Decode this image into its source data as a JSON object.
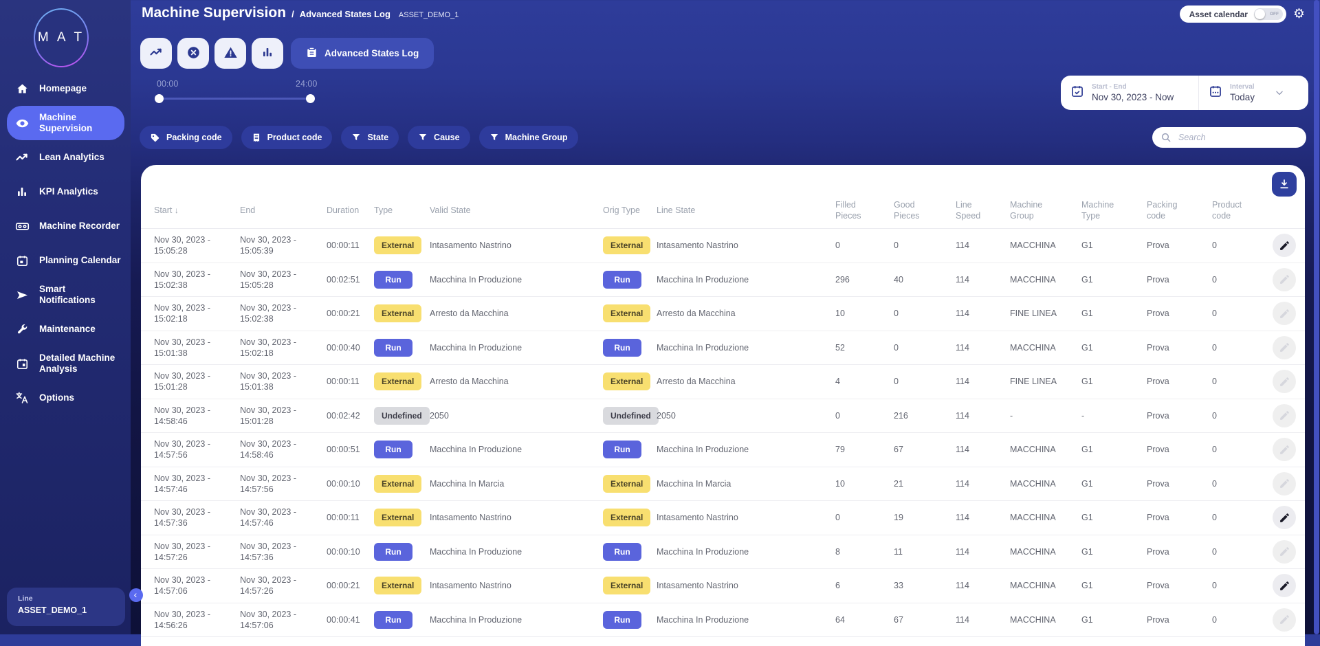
{
  "header": {
    "title": "Machine Supervision",
    "breadcrumb_separator": "/",
    "breadcrumb": "Advanced States Log",
    "asset_id": "ASSET_DEMO_1",
    "asset_calendar_label": "Asset calendar",
    "asset_calendar_toggle": "OFF"
  },
  "sidebar": {
    "logo_text": "M A T",
    "items": [
      {
        "label": "Homepage",
        "icon": "home-icon",
        "active": false
      },
      {
        "label": "Machine Supervision",
        "icon": "eye-icon",
        "active": true
      },
      {
        "label": "Lean Analytics",
        "icon": "trend-icon",
        "active": false
      },
      {
        "label": "KPI Analytics",
        "icon": "bar-chart-icon",
        "active": false
      },
      {
        "label": "Machine Recorder",
        "icon": "recorder-icon",
        "active": false
      },
      {
        "label": "Planning Calendar",
        "icon": "calendar-icon",
        "active": false
      },
      {
        "label": "Smart Notifications",
        "icon": "send-icon",
        "active": false
      },
      {
        "label": "Maintenance",
        "icon": "wrench-icon",
        "active": false
      },
      {
        "label": "Detailed Machine Analysis",
        "icon": "calendar-analysis-icon",
        "active": false
      },
      {
        "label": "Options",
        "icon": "translate-icon",
        "active": false
      }
    ],
    "line_label": "Line",
    "line_value": "ASSET_DEMO_1",
    "collapse_glyph": "‹"
  },
  "toolbar": {
    "icon_buttons": [
      {
        "icon": "trend-icon"
      },
      {
        "icon": "circle-x-icon"
      },
      {
        "icon": "warning-icon"
      },
      {
        "icon": "bar-chart-icon"
      }
    ],
    "active_view_label": "Advanced States Log",
    "active_view_icon": "clipboard-icon"
  },
  "time_slider": {
    "start_label": "00:00",
    "end_label": "24:00"
  },
  "date_picker": {
    "start_end_label": "Start - End",
    "start_end_value": "Nov 30, 2023 - Now",
    "interval_label": "Interval",
    "interval_value": "Today"
  },
  "filters": [
    {
      "label": "Packing code",
      "icon": "tag-icon"
    },
    {
      "label": "Product code",
      "icon": "receipt-icon"
    },
    {
      "label": "State",
      "icon": "funnel-icon"
    },
    {
      "label": "Cause",
      "icon": "funnel-icon"
    },
    {
      "label": "Machine Group",
      "icon": "funnel-icon"
    }
  ],
  "search": {
    "placeholder": "Search"
  },
  "colors": {
    "accent": "#5a6af0",
    "scrollbar": "#4350c0",
    "badge_external_bg": "#f8df70",
    "badge_external_fg": "#4a4327",
    "badge_run_bg": "#5a64dc",
    "badge_run_fg": "#ffffff",
    "badge_undefined_bg": "#d9dade",
    "badge_undefined_fg": "#3d3d49"
  },
  "table": {
    "columns": [
      {
        "id": "start",
        "lines": [
          "Start"
        ],
        "sorted": "desc"
      },
      {
        "id": "end",
        "lines": [
          "End"
        ]
      },
      {
        "id": "duration",
        "lines": [
          "Duration"
        ]
      },
      {
        "id": "type",
        "lines": [
          "Type"
        ]
      },
      {
        "id": "valid-state",
        "lines": [
          "Valid State"
        ]
      },
      {
        "id": "orig-type",
        "lines": [
          "Orig Type"
        ]
      },
      {
        "id": "line-state",
        "lines": [
          "Line State"
        ]
      },
      {
        "id": "filled-pieces",
        "lines": [
          "Filled",
          "Pieces"
        ]
      },
      {
        "id": "good-pieces",
        "lines": [
          "Good",
          "Pieces"
        ]
      },
      {
        "id": "line-speed",
        "lines": [
          "Line",
          "Speed"
        ]
      },
      {
        "id": "machine-group",
        "lines": [
          "Machine",
          "Group"
        ]
      },
      {
        "id": "machine-type",
        "lines": [
          "Machine",
          "Type"
        ]
      },
      {
        "id": "packing-code",
        "lines": [
          "Packing",
          "code"
        ]
      },
      {
        "id": "product-code",
        "lines": [
          "Product",
          "code"
        ]
      }
    ],
    "rows": [
      {
        "start": [
          "Nov 30, 2023 -",
          "15:05:28"
        ],
        "end": [
          "Nov 30, 2023 -",
          "15:05:39"
        ],
        "duration": "00:00:11",
        "type": "External",
        "valid_state": "Intasamento Nastrino",
        "orig_type": "External",
        "line_state": "Intasamento Nastrino",
        "filled_pieces": "0",
        "good_pieces": "0",
        "line_speed": "114",
        "machine_group": "MACCHINA",
        "machine_type": "G1",
        "packing_code": "Prova",
        "product_code": "0",
        "editable": true
      },
      {
        "start": [
          "Nov 30, 2023 -",
          "15:02:38"
        ],
        "end": [
          "Nov 30, 2023 -",
          "15:05:28"
        ],
        "duration": "00:02:51",
        "type": "Run",
        "valid_state": "Macchina In Produzione",
        "orig_type": "Run",
        "line_state": "Macchina In Produzione",
        "filled_pieces": "296",
        "good_pieces": "40",
        "line_speed": "114",
        "machine_group": "MACCHINA",
        "machine_type": "G1",
        "packing_code": "Prova",
        "product_code": "0",
        "editable": false
      },
      {
        "start": [
          "Nov 30, 2023 -",
          "15:02:18"
        ],
        "end": [
          "Nov 30, 2023 -",
          "15:02:38"
        ],
        "duration": "00:00:21",
        "type": "External",
        "valid_state": "Arresto da Macchina",
        "orig_type": "External",
        "line_state": "Arresto da Macchina",
        "filled_pieces": "10",
        "good_pieces": "0",
        "line_speed": "114",
        "machine_group": "FINE LINEA",
        "machine_type": "G1",
        "packing_code": "Prova",
        "product_code": "0",
        "editable": false
      },
      {
        "start": [
          "Nov 30, 2023 -",
          "15:01:38"
        ],
        "end": [
          "Nov 30, 2023 -",
          "15:02:18"
        ],
        "duration": "00:00:40",
        "type": "Run",
        "valid_state": "Macchina In Produzione",
        "orig_type": "Run",
        "line_state": "Macchina In Produzione",
        "filled_pieces": "52",
        "good_pieces": "0",
        "line_speed": "114",
        "machine_group": "MACCHINA",
        "machine_type": "G1",
        "packing_code": "Prova",
        "product_code": "0",
        "editable": false
      },
      {
        "start": [
          "Nov 30, 2023 -",
          "15:01:28"
        ],
        "end": [
          "Nov 30, 2023 -",
          "15:01:38"
        ],
        "duration": "00:00:11",
        "type": "External",
        "valid_state": "Arresto da Macchina",
        "orig_type": "External",
        "line_state": "Arresto da Macchina",
        "filled_pieces": "4",
        "good_pieces": "0",
        "line_speed": "114",
        "machine_group": "FINE LINEA",
        "machine_type": "G1",
        "packing_code": "Prova",
        "product_code": "0",
        "editable": false
      },
      {
        "start": [
          "Nov 30, 2023 -",
          "14:58:46"
        ],
        "end": [
          "Nov 30, 2023 -",
          "15:01:28"
        ],
        "duration": "00:02:42",
        "type": "Undefined",
        "valid_state": "2050",
        "orig_type": "Undefined",
        "line_state": "2050",
        "filled_pieces": "0",
        "good_pieces": "216",
        "line_speed": "114",
        "machine_group": "-",
        "machine_type": "-",
        "packing_code": "Prova",
        "product_code": "0",
        "editable": false
      },
      {
        "start": [
          "Nov 30, 2023 -",
          "14:57:56"
        ],
        "end": [
          "Nov 30, 2023 -",
          "14:58:46"
        ],
        "duration": "00:00:51",
        "type": "Run",
        "valid_state": "Macchina In Produzione",
        "orig_type": "Run",
        "line_state": "Macchina In Produzione",
        "filled_pieces": "79",
        "good_pieces": "67",
        "line_speed": "114",
        "machine_group": "MACCHINA",
        "machine_type": "G1",
        "packing_code": "Prova",
        "product_code": "0",
        "editable": false
      },
      {
        "start": [
          "Nov 30, 2023 -",
          "14:57:46"
        ],
        "end": [
          "Nov 30, 2023 -",
          "14:57:56"
        ],
        "duration": "00:00:10",
        "type": "External",
        "valid_state": "Macchina In Marcia",
        "orig_type": "External",
        "line_state": "Macchina In Marcia",
        "filled_pieces": "10",
        "good_pieces": "21",
        "line_speed": "114",
        "machine_group": "MACCHINA",
        "machine_type": "G1",
        "packing_code": "Prova",
        "product_code": "0",
        "editable": false
      },
      {
        "start": [
          "Nov 30, 2023 -",
          "14:57:36"
        ],
        "end": [
          "Nov 30, 2023 -",
          "14:57:46"
        ],
        "duration": "00:00:11",
        "type": "External",
        "valid_state": "Intasamento Nastrino",
        "orig_type": "External",
        "line_state": "Intasamento Nastrino",
        "filled_pieces": "0",
        "good_pieces": "19",
        "line_speed": "114",
        "machine_group": "MACCHINA",
        "machine_type": "G1",
        "packing_code": "Prova",
        "product_code": "0",
        "editable": true
      },
      {
        "start": [
          "Nov 30, 2023 -",
          "14:57:26"
        ],
        "end": [
          "Nov 30, 2023 -",
          "14:57:36"
        ],
        "duration": "00:00:10",
        "type": "Run",
        "valid_state": "Macchina In Produzione",
        "orig_type": "Run",
        "line_state": "Macchina In Produzione",
        "filled_pieces": "8",
        "good_pieces": "11",
        "line_speed": "114",
        "machine_group": "MACCHINA",
        "machine_type": "G1",
        "packing_code": "Prova",
        "product_code": "0",
        "editable": false
      },
      {
        "start": [
          "Nov 30, 2023 -",
          "14:57:06"
        ],
        "end": [
          "Nov 30, 2023 -",
          "14:57:26"
        ],
        "duration": "00:00:21",
        "type": "External",
        "valid_state": "Intasamento Nastrino",
        "orig_type": "External",
        "line_state": "Intasamento Nastrino",
        "filled_pieces": "6",
        "good_pieces": "33",
        "line_speed": "114",
        "machine_group": "MACCHINA",
        "machine_type": "G1",
        "packing_code": "Prova",
        "product_code": "0",
        "editable": true
      },
      {
        "start": [
          "Nov 30, 2023 -",
          "14:56:26"
        ],
        "end": [
          "Nov 30, 2023 -",
          "14:57:06"
        ],
        "duration": "00:00:41",
        "type": "Run",
        "valid_state": "Macchina In Produzione",
        "orig_type": "Run",
        "line_state": "Macchina In Produzione",
        "filled_pieces": "64",
        "good_pieces": "67",
        "line_speed": "114",
        "machine_group": "MACCHINA",
        "machine_type": "G1",
        "packing_code": "Prova",
        "product_code": "0",
        "editable": false
      }
    ]
  }
}
